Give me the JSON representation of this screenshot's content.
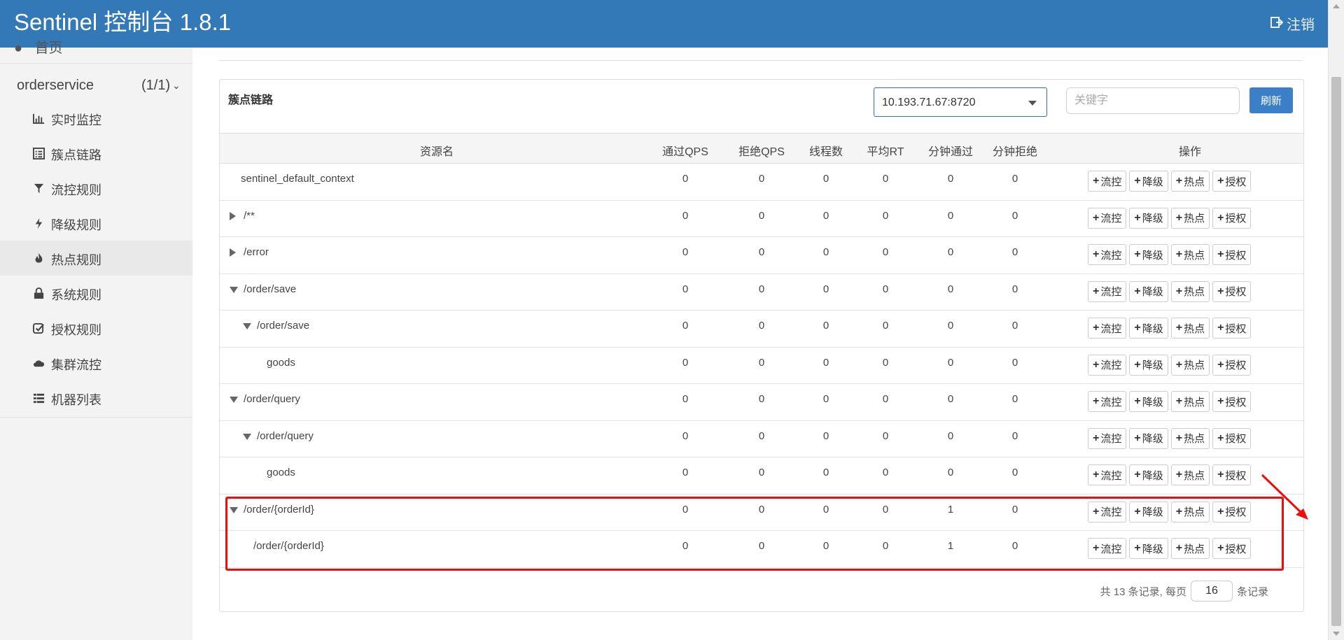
{
  "header": {
    "title": "Sentinel 控制台 1.8.1",
    "logout_label": "注销"
  },
  "sidebar": {
    "home_label": "首页",
    "app": {
      "name": "orderservice",
      "count": "(1/1)"
    },
    "items": [
      {
        "label": "实时监控",
        "icon": "bar-chart-icon"
      },
      {
        "label": "簇点链路",
        "icon": "list-alt-icon"
      },
      {
        "label": "流控规则",
        "icon": "filter-icon"
      },
      {
        "label": "降级规则",
        "icon": "flash-icon"
      },
      {
        "label": "热点规则",
        "icon": "fire-icon"
      },
      {
        "label": "系统规则",
        "icon": "lock-icon"
      },
      {
        "label": "授权规则",
        "icon": "check-icon"
      },
      {
        "label": "集群流控",
        "icon": "cloud-icon"
      },
      {
        "label": "机器列表",
        "icon": "th-list-icon"
      }
    ],
    "active_item": "热点规则"
  },
  "panel": {
    "title": "簇点链路",
    "machine": "10.193.71.67:8720",
    "search_placeholder": "关键字",
    "refresh_label": "刷新"
  },
  "table": {
    "columns": [
      "资源名",
      "通过QPS",
      "拒绝QPS",
      "线程数",
      "平均RT",
      "分钟通过",
      "分钟拒绝",
      "操作"
    ],
    "actions": [
      "流控",
      "降级",
      "热点",
      "授权"
    ],
    "rows": [
      {
        "name": "sentinel_default_context",
        "toggle": "none",
        "level": 0,
        "values": [
          "0",
          "0",
          "0",
          "0",
          "0",
          "0"
        ]
      },
      {
        "name": "/**",
        "toggle": "collapsed",
        "level": 0,
        "values": [
          "0",
          "0",
          "0",
          "0",
          "0",
          "0"
        ]
      },
      {
        "name": "/error",
        "toggle": "collapsed",
        "level": 0,
        "values": [
          "0",
          "0",
          "0",
          "0",
          "0",
          "0"
        ]
      },
      {
        "name": "/order/save",
        "toggle": "expanded",
        "level": 0,
        "values": [
          "0",
          "0",
          "0",
          "0",
          "0",
          "0"
        ]
      },
      {
        "name": "/order/save",
        "toggle": "expanded",
        "level": 1,
        "values": [
          "0",
          "0",
          "0",
          "0",
          "0",
          "0"
        ]
      },
      {
        "name": "goods",
        "toggle": "none",
        "level": 2,
        "values": [
          "0",
          "0",
          "0",
          "0",
          "0",
          "0"
        ]
      },
      {
        "name": "/order/query",
        "toggle": "expanded",
        "level": 0,
        "values": [
          "0",
          "0",
          "0",
          "0",
          "0",
          "0"
        ]
      },
      {
        "name": "/order/query",
        "toggle": "expanded",
        "level": 1,
        "values": [
          "0",
          "0",
          "0",
          "0",
          "0",
          "0"
        ]
      },
      {
        "name": "goods",
        "toggle": "none",
        "level": 2,
        "values": [
          "0",
          "0",
          "0",
          "0",
          "0",
          "0"
        ]
      },
      {
        "name": "/order/{orderId}",
        "toggle": "expanded",
        "level": 0,
        "values": [
          "0",
          "0",
          "0",
          "0",
          "1",
          "0"
        ]
      },
      {
        "name": "/order/{orderId}",
        "toggle": "none",
        "level": 1,
        "values": [
          "0",
          "0",
          "0",
          "0",
          "1",
          "0"
        ]
      }
    ]
  },
  "pagination": {
    "prefix": "共 13 条记录, 每页",
    "page_size": "16",
    "suffix": "条记录"
  },
  "annotation": {
    "highlight_color": "#f20d0d"
  }
}
